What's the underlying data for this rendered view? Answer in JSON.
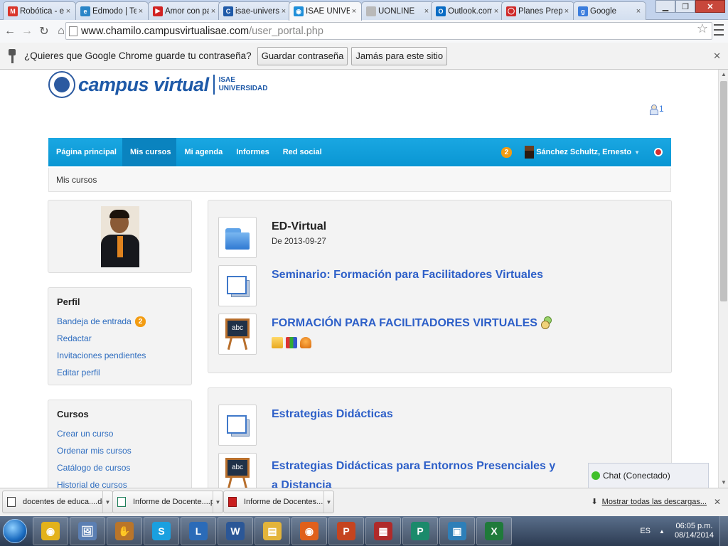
{
  "browser": {
    "tabs": [
      {
        "label": "Robótica - ersa",
        "favicon": "gmail-icon",
        "color": "#d9352a",
        "glyph": "M"
      },
      {
        "label": "Edmodo | Tec",
        "favicon": "edmodo-icon",
        "color": "#2a85c7",
        "glyph": "e"
      },
      {
        "label": "Amor con pap",
        "favicon": "youtube-icon",
        "color": "#d12323",
        "glyph": "▶"
      },
      {
        "label": "isae-universida",
        "favicon": "isae-icon",
        "color": "#1f5aa8",
        "glyph": "C"
      },
      {
        "label": "ISAE UNIVERSI",
        "favicon": "isae-icon",
        "color": "#1f8fd9",
        "glyph": "◉"
      },
      {
        "label": "UONLINE",
        "favicon": "page-icon",
        "color": "#b9b9b9",
        "glyph": ""
      },
      {
        "label": "Outlook.com -",
        "favicon": "outlook-icon",
        "color": "#0a6cc4",
        "glyph": "O"
      },
      {
        "label": "Planes Prepag",
        "favicon": "opera-icon",
        "color": "#cf2a2a",
        "glyph": "◯"
      },
      {
        "label": "Google",
        "favicon": "google-icon",
        "color": "#3b7ddd",
        "glyph": "g"
      }
    ],
    "active_tab": 4,
    "url_host": "www.chamilo.campusvirtualisae.com",
    "url_path": "/user_portal.php"
  },
  "infobar": {
    "message": "¿Quieres que Google Chrome guarde tu contraseña?",
    "save_label": "Guardar contraseña",
    "never_label": "Jamás para este sitio"
  },
  "site": {
    "brand": "campus virtual",
    "sub_line1": "ISAE",
    "sub_line2": "UNIVERSIDAD",
    "online_count": "1"
  },
  "nav": {
    "items": [
      "Página principal",
      "Mis cursos",
      "Mi agenda",
      "Informes",
      "Red social"
    ],
    "active_index": 1,
    "notif_count": "2",
    "user_name": "Sánchez Schultz, Ernesto"
  },
  "breadcrumb": "Mis cursos",
  "perfil": {
    "heading": "Perfil",
    "links": [
      "Bandeja de entrada",
      "Redactar",
      "Invitaciones pendientes",
      "Editar perfil"
    ],
    "inbox_count": "2"
  },
  "cursos": {
    "heading": "Cursos",
    "links": [
      "Crear un curso",
      "Ordenar mis cursos",
      "Catálogo de cursos",
      "Historial de cursos"
    ]
  },
  "courses": {
    "group1": {
      "title": "ED-Virtual",
      "date": "De 2013-09-27",
      "items": [
        "Seminario: Formación para Facilitadores Virtuales",
        "FORMACIÓN PARA FACILITADORES VIRTUALES"
      ]
    },
    "group2": {
      "items": [
        "Estrategias Didácticas",
        "Estrategias Didácticas para Entornos Presenciales y",
        "a Distancia"
      ]
    }
  },
  "chat_label": "Chat (Conectado)",
  "downloads": {
    "items": [
      "docentes de educa....docx",
      "Informe de Docente....pub",
      "Informe de Docentes....pdf"
    ],
    "show_all": "Mostrar todas las descargas..."
  },
  "taskbar": {
    "lang": "ES",
    "time": "06:05 p.m.",
    "date": "08/14/2014",
    "apps": [
      {
        "name": "chrome-icon",
        "color": "#e3b21b",
        "glyph": "◉"
      },
      {
        "name": "paint-icon",
        "color": "#5b7fb3",
        "glyph": "🖼"
      },
      {
        "name": "hand-icon",
        "color": "#b9752a",
        "glyph": "✋"
      },
      {
        "name": "skype-icon",
        "color": "#1aa0e0",
        "glyph": "S"
      },
      {
        "name": "lync-icon",
        "color": "#2b6bb8",
        "glyph": "L"
      },
      {
        "name": "word-icon",
        "color": "#2b5797",
        "glyph": "W"
      },
      {
        "name": "explorer-icon",
        "color": "#e3b43a",
        "glyph": "▤"
      },
      {
        "name": "firefox-icon",
        "color": "#e0601b",
        "glyph": "◉"
      },
      {
        "name": "powerpoint-icon",
        "color": "#c5441f",
        "glyph": "P"
      },
      {
        "name": "calculator-icon",
        "color": "#b02a2a",
        "glyph": "▦"
      },
      {
        "name": "publisher-icon",
        "color": "#1b8a6b",
        "glyph": "P"
      },
      {
        "name": "picture-icon",
        "color": "#2e7fb8",
        "glyph": "▣"
      },
      {
        "name": "excel-icon",
        "color": "#1f7a3a",
        "glyph": "X"
      }
    ]
  }
}
